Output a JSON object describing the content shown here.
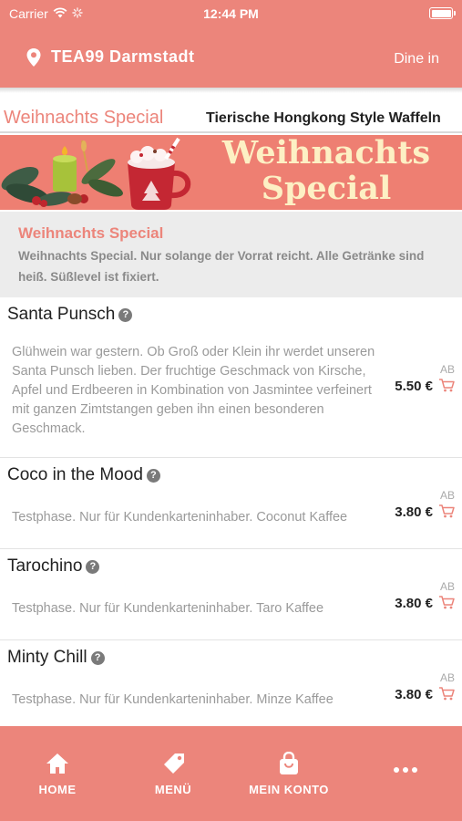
{
  "status": {
    "carrier": "Carrier",
    "time": "12:44 PM"
  },
  "header": {
    "store_name": "TEA99 Darmstadt",
    "mode": "Dine in"
  },
  "tabs": [
    {
      "label": "Weihnachts Special",
      "active": true
    },
    {
      "label": "Tierische Hongkong Style Waffeln",
      "active": false
    }
  ],
  "banner": {
    "title_line1": "Weihnachts",
    "title_line2": "Special"
  },
  "category": {
    "title": "Weihnachts Special",
    "description": "Weihnachts Special. Nur solange der Vorrat reicht. Alle Getränke sind heiß. Süßlevel ist fixiert."
  },
  "products": [
    {
      "name": "Santa Punsch",
      "description": "Glühwein war gestern. Ob Groß oder Klein ihr werdet unseren Santa Punsch lieben. Der fruchtige Geschmack von Kirsche, Apfel und Erdbeeren in Kombination von Jasmintee verfeinert mit ganzen Zimtstangen geben ihn einen besonderen Geschmack.",
      "ab": "AB",
      "price": "5.50 €"
    },
    {
      "name": "Coco in the Mood",
      "description": "Testphase. Nur für Kundenkarteninhaber. Coconut Kaffee",
      "ab": "AB",
      "price": "3.80 €"
    },
    {
      "name": "Tarochino",
      "description": "Testphase. Nur für Kundenkarteninhaber. Taro Kaffee",
      "ab": "AB",
      "price": "3.80 €"
    },
    {
      "name": "Minty Chill",
      "description": "Testphase. Nur für Kundenkarteninhaber. Minze Kaffee",
      "ab": "AB",
      "price": "3.80 €"
    }
  ],
  "nav": [
    {
      "label": "HOME",
      "icon": "home-icon"
    },
    {
      "label": "MENÜ",
      "icon": "tag-icon"
    },
    {
      "label": "MEIN KONTO",
      "icon": "bag-icon"
    },
    {
      "label": "",
      "icon": "more-icon"
    }
  ],
  "colors": {
    "primary": "#ec857b",
    "banner_text": "#fdf0c4",
    "muted": "#9a9a9a"
  }
}
